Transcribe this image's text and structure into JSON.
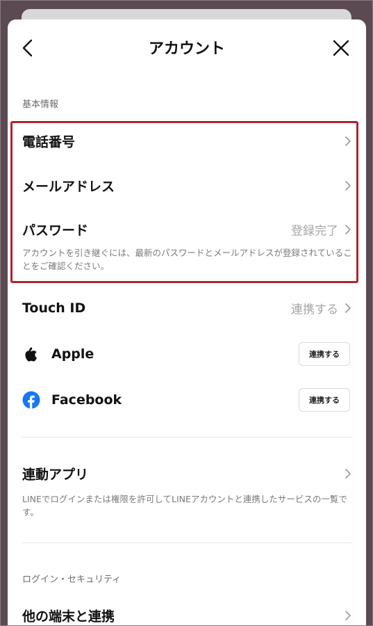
{
  "header": {
    "title": "アカウント"
  },
  "basic_info": {
    "section_label": "基本情報",
    "phone": {
      "label": "電話番号"
    },
    "email": {
      "label": "メールアドレス"
    },
    "password": {
      "label": "パスワード",
      "value": "登録完了"
    },
    "note": "アカウントを引き継ぐには、最新のパスワードとメールアドレスが登録されていることをご確認ください。"
  },
  "touch_id": {
    "label": "Touch ID",
    "value": "連携する"
  },
  "apple": {
    "label": "Apple",
    "button": "連携する"
  },
  "facebook": {
    "label": "Facebook",
    "button": "連携する"
  },
  "linked_apps": {
    "label": "連動アプリ",
    "note": "LINEでログインまたは権限を許可してLINEアカウントと連携したサービスの一覧です。"
  },
  "login_security": {
    "section_label": "ログイン・セキュリティ",
    "other_devices": {
      "label": "他の端末と連携"
    }
  },
  "colors": {
    "highlight_border": "#b3222e",
    "facebook_blue": "#1877f2",
    "secondary_text": "#a6a6a6"
  }
}
